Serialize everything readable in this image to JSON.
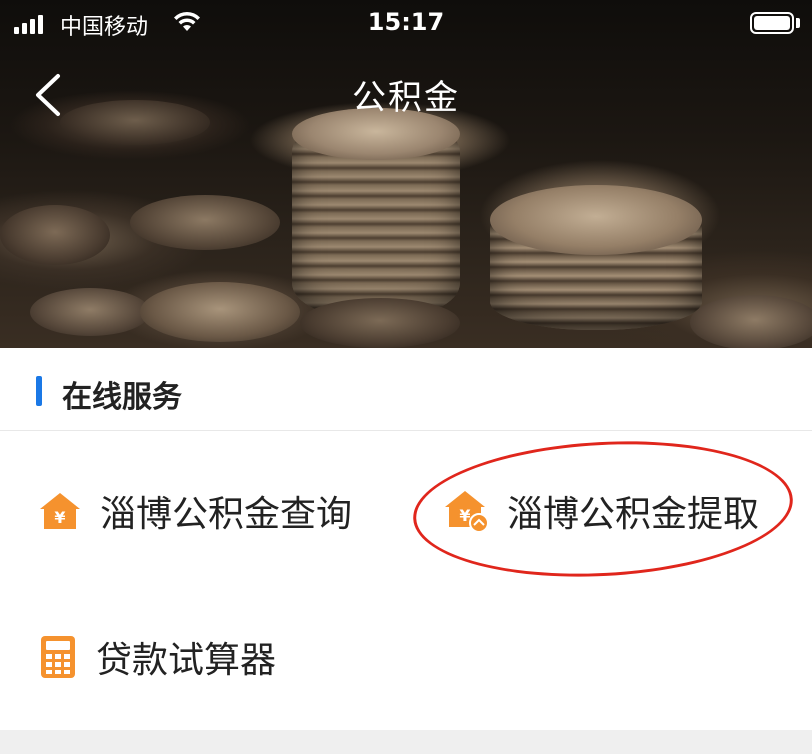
{
  "status_bar": {
    "carrier": "中国移动",
    "time": "15:17"
  },
  "nav": {
    "title": "公积金",
    "back_icon": "chevron-left-icon"
  },
  "section": {
    "title": "在线服务"
  },
  "services": [
    {
      "label": "淄博公积金查询",
      "icon": "house-yuan-icon"
    },
    {
      "label": "淄博公积金提取",
      "icon": "house-yuan-withdraw-icon"
    },
    {
      "label": "贷款试算器",
      "icon": "calculator-icon"
    }
  ],
  "colors": {
    "accent_blue": "#1a78e6",
    "icon_orange": "#f5922e",
    "highlight_red": "#e0261c"
  }
}
